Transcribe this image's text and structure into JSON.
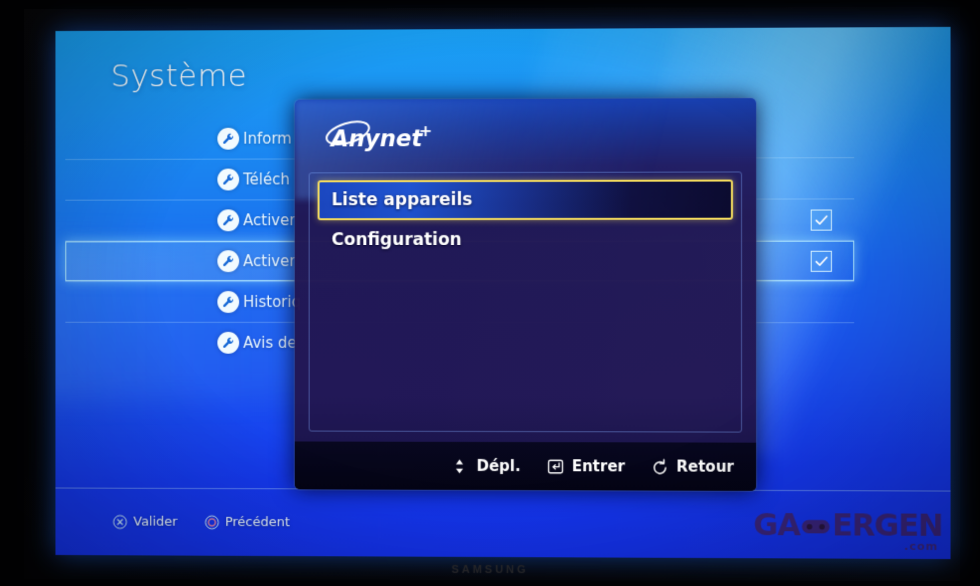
{
  "device": {
    "brand_logo": "SAMSUNG"
  },
  "page": {
    "title": "Système"
  },
  "settings": {
    "items": [
      {
        "label": "Inform",
        "icon": "wrench-icon",
        "selected": false,
        "checked": false
      },
      {
        "label": "Téléch",
        "icon": "wrench-icon",
        "selected": false,
        "checked": false
      },
      {
        "label": "Activer",
        "icon": "wrench-icon",
        "selected": false,
        "checked": true
      },
      {
        "label": "Activer",
        "icon": "wrench-icon",
        "selected": true,
        "checked": true
      },
      {
        "label": "Historiq",
        "icon": "wrench-icon",
        "selected": false,
        "checked": false
      },
      {
        "label": "Avis de",
        "icon": "wrench-icon",
        "selected": false,
        "checked": false
      }
    ]
  },
  "console_hints": [
    {
      "glyph": "cross-button-icon",
      "label": "Valider"
    },
    {
      "glyph": "circle-button-icon",
      "label": "Précédent"
    }
  ],
  "dialog": {
    "logo_text": "Anynet",
    "logo_plus": "+",
    "menu": [
      {
        "label": "Liste appareils",
        "highlighted": true
      },
      {
        "label": "Configuration",
        "highlighted": false
      }
    ],
    "footer_hints": [
      {
        "glyph": "up-down-arrow-icon",
        "label": "Dépl."
      },
      {
        "glyph": "enter-key-icon",
        "label": "Entrer"
      },
      {
        "glyph": "return-arrow-icon",
        "label": "Retour"
      }
    ]
  },
  "watermark": {
    "text_before": "GA",
    "text_after": "ERGEN",
    "domain": ".com"
  },
  "colors": {
    "screen_blue_top": "#1aa3f5",
    "screen_blue_bottom": "#1430ea",
    "highlight_yellow": "#f5dc5e",
    "dialog_navy": "#221652",
    "text_white": "#ffffff"
  }
}
